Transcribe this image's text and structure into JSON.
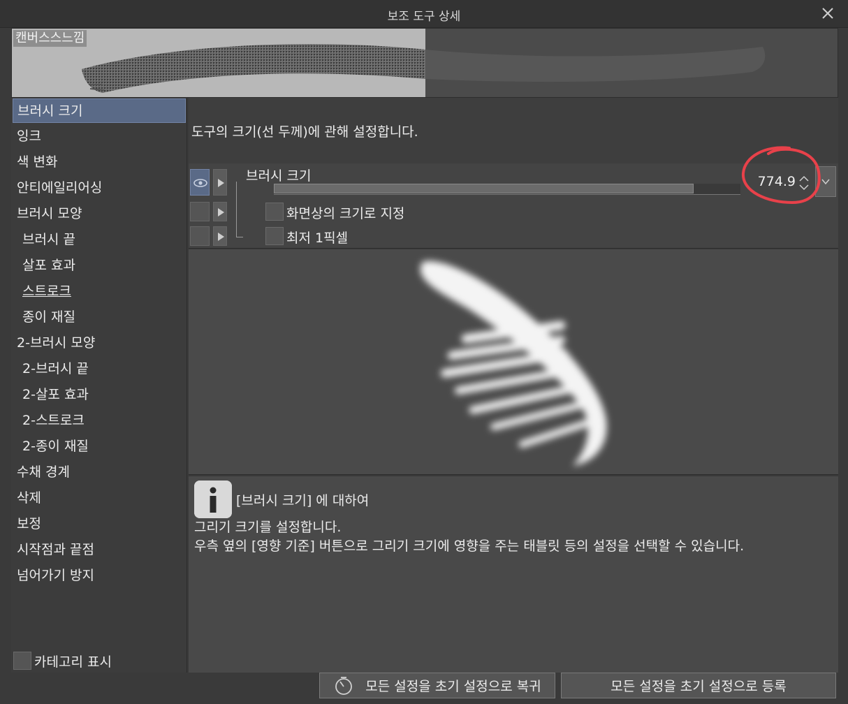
{
  "window": {
    "title": "보조 도구 상세"
  },
  "preview": {
    "name": "캔버스스느낌"
  },
  "sidebar": {
    "items": [
      {
        "label": "브러시 크기"
      },
      {
        "label": "잉크"
      },
      {
        "label": "색 변화"
      },
      {
        "label": "안티에일리어싱"
      },
      {
        "label": "브러시 모양"
      },
      {
        "label": "브러시 끝"
      },
      {
        "label": "살포 효과"
      },
      {
        "label": "스트로크"
      },
      {
        "label": "종이 재질"
      },
      {
        "label": "2-브러시 모양"
      },
      {
        "label": "2-브러시 끝"
      },
      {
        "label": "2-살포 효과"
      },
      {
        "label": "2-스트로크"
      },
      {
        "label": "2-종이 재질"
      },
      {
        "label": "수채 경계"
      },
      {
        "label": "삭제"
      },
      {
        "label": "보정"
      },
      {
        "label": "시작점과 끝점"
      },
      {
        "label": "넘어가기 방지"
      }
    ],
    "category_label": "카테고리 표시"
  },
  "description": "도구의 크기(선 두께)에 관해 설정합니다.",
  "settings": {
    "brush_size_label": "브러시 크기",
    "brush_size_value": "774.9",
    "brush_size_fraction": 0.9,
    "screen_size_label": "화면상의 크기로 지정",
    "min_pixel_label": "최저 1픽셀"
  },
  "info": {
    "heading": "[브러시 크기] 에 대하여",
    "line1": "그리기 크기를 설정합니다.",
    "line2": "우측 옆의 [영향 기준] 버튼으로 그리기 크기에 영향을 주는 태블릿 등의 설정을 선택할 수 있습니다."
  },
  "buttons": {
    "restore": "모든 설정을 초기 설정으로 복귀",
    "register": "모든 설정을 초기 설정으로 등록"
  },
  "colors": {
    "selection": "#5a6a87",
    "annotation": "#e8414a"
  }
}
